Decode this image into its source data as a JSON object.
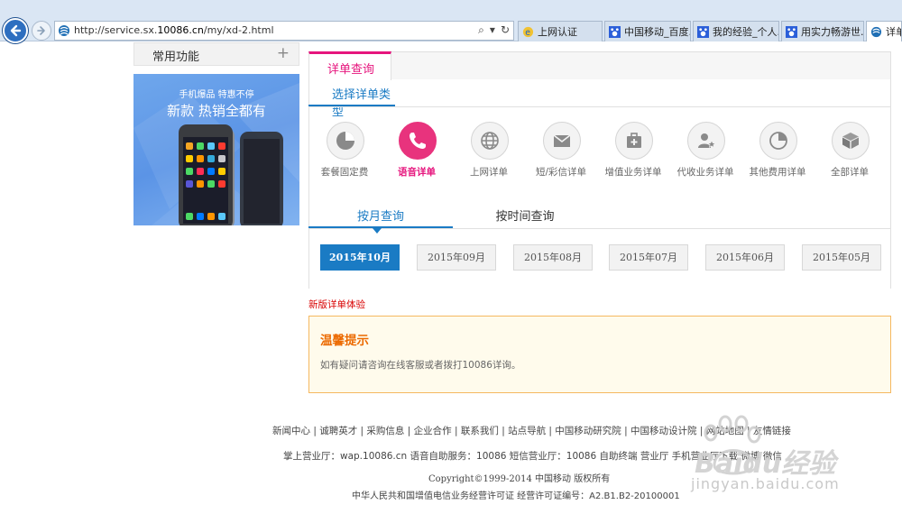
{
  "browser": {
    "url_prefix": "http://service.sx.",
    "url_domain": "10086.cn",
    "url_path": "/my/xd-2.html",
    "tabs": [
      {
        "label": "上网认证"
      },
      {
        "label": "中国移动_百度..."
      },
      {
        "label": "我的经验_个人..."
      },
      {
        "label": "用实力畅游世..."
      },
      {
        "label": "详单"
      }
    ]
  },
  "sidebar": {
    "title": "常用功能",
    "plus": "+",
    "promo_line1": "手机爆品 特惠不停",
    "promo_line2": "新款 热销全都有"
  },
  "main": {
    "tab_label": "详单查询",
    "type_heading": "选择详单类型",
    "categories": [
      {
        "label": "套餐固定费",
        "icon": "pie-chart-icon"
      },
      {
        "label": "语音详单",
        "icon": "phone-icon",
        "active": true
      },
      {
        "label": "上网详单",
        "icon": "globe-icon"
      },
      {
        "label": "短/彩信详单",
        "icon": "envelope-icon"
      },
      {
        "label": "增值业务详单",
        "icon": "medical-kit-icon"
      },
      {
        "label": "代收业务详单",
        "icon": "user-star-icon"
      },
      {
        "label": "其他费用详单",
        "icon": "pie-chart-icon"
      },
      {
        "label": "全部详单",
        "icon": "box-icon"
      }
    ],
    "query_tabs": [
      {
        "label": "按月查询",
        "active": true
      },
      {
        "label": "按时间查询"
      }
    ],
    "months": [
      "2015年10月",
      "2015年09月",
      "2015年08月",
      "2015年07月",
      "2015年06月",
      "2015年05月"
    ],
    "new_experience": "新版详单体验",
    "tip_title": "温馨提示",
    "tip_text": "如有疑问请咨询在线客服或者拨打10086详询。"
  },
  "footer": {
    "links": "新闻中心 | 诚聘英才 | 采购信息 | 企业合作 | 联系我们 | 站点导航 | 中国移动研究院 | 中国移动设计院 | 网站地图 | 友情链接",
    "hall": "掌上营业厅：wap.10086.cn 语音自助服务：10086 短信营业厅：10086 自助终端 营业厅 手机营业厅下载 微博 微信",
    "copyright": "Copyright©1999-2014  中国移动  版权所有",
    "license": "中华人民共和国增值电信业务经营许可证  经营许可证编号：A2.B1.B2-20100001"
  },
  "watermark": {
    "text": "Baidu经验",
    "site": "jingyan.baidu.com"
  },
  "colors": {
    "accent_blue": "#1a7bc4",
    "accent_pink": "#e6157d",
    "tip_orange": "#ec6a00"
  }
}
